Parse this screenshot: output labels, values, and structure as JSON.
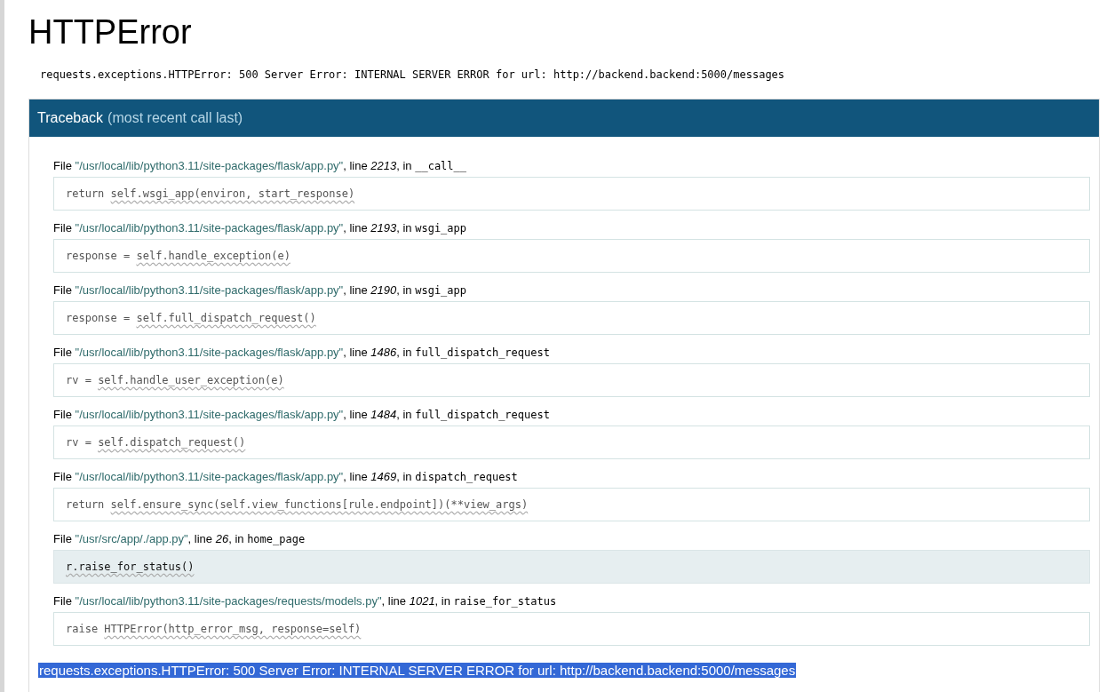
{
  "title": "HTTPError",
  "message": "requests.exceptions.HTTPError: 500 Server Error: INTERNAL SERVER ERROR for url: http://backend.backend:5000/messages",
  "traceback": {
    "title": "Traceback",
    "subtitle": "(most recent call last)",
    "frames": [
      {
        "label": "File",
        "path": "\"/usr/local/lib/python3.11/site-packages/flask/app.py\"",
        "line_label": ", line",
        "line": "2213",
        "in_label": ", in",
        "function": "__call__",
        "code_before": "return ",
        "code_error": "self.wsgi_app(environ, start_response)",
        "current": false
      },
      {
        "label": "File",
        "path": "\"/usr/local/lib/python3.11/site-packages/flask/app.py\"",
        "line_label": ", line",
        "line": "2193",
        "in_label": ", in",
        "function": "wsgi_app",
        "code_before": "response = ",
        "code_error": "self.handle_exception(e)",
        "current": false
      },
      {
        "label": "File",
        "path": "\"/usr/local/lib/python3.11/site-packages/flask/app.py\"",
        "line_label": ", line",
        "line": "2190",
        "in_label": ", in",
        "function": "wsgi_app",
        "code_before": "response = ",
        "code_error": "self.full_dispatch_request()",
        "current": false
      },
      {
        "label": "File",
        "path": "\"/usr/local/lib/python3.11/site-packages/flask/app.py\"",
        "line_label": ", line",
        "line": "1486",
        "in_label": ", in",
        "function": "full_dispatch_request",
        "code_before": "rv = ",
        "code_error": "self.handle_user_exception(e)",
        "current": false
      },
      {
        "label": "File",
        "path": "\"/usr/local/lib/python3.11/site-packages/flask/app.py\"",
        "line_label": ", line",
        "line": "1484",
        "in_label": ", in",
        "function": "full_dispatch_request",
        "code_before": "rv = ",
        "code_error": "self.dispatch_request()",
        "current": false
      },
      {
        "label": "File",
        "path": "\"/usr/local/lib/python3.11/site-packages/flask/app.py\"",
        "line_label": ", line",
        "line": "1469",
        "in_label": ", in",
        "function": "dispatch_request",
        "code_before": "return ",
        "code_error": "self.ensure_sync(self.view_functions[rule.endpoint])(**view_args)",
        "current": false
      },
      {
        "label": "File",
        "path": "\"/usr/src/app/./app.py\"",
        "line_label": ", line",
        "line": "26",
        "in_label": ", in",
        "function": "home_page",
        "code_error": "r.raise_for_status()",
        "current": true
      },
      {
        "label": "File",
        "path": "\"/usr/local/lib/python3.11/site-packages/requests/models.py\"",
        "line_label": ", line",
        "line": "1021",
        "in_label": ", in",
        "function": "raise_for_status",
        "code_before": "raise ",
        "code_error": "HTTPError(http_error_msg, response=self)",
        "current": false
      }
    ],
    "exception": {
      "text": "requests.exceptions.HTTPError: 500 Server Error: INTERNAL SERVER ERROR for url: http://backend.backend:5000/messages",
      "selected": true
    }
  }
}
